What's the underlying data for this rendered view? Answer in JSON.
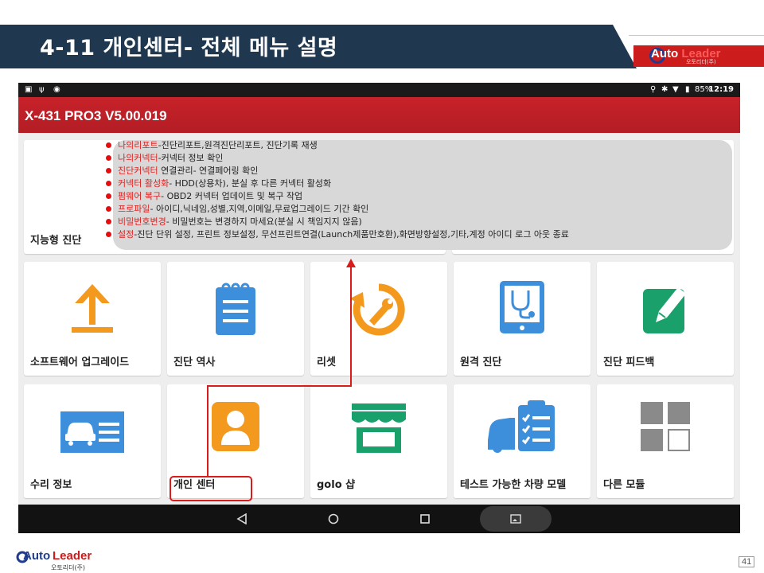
{
  "slide": {
    "title": "4-11 개인센터- 전체 메뉴 설명",
    "page_number": "41"
  },
  "logo": {
    "brand_auto": "Auto",
    "brand_leader": "Leader",
    "subtitle": "오토리더(주)"
  },
  "tablet": {
    "status": {
      "battery": "85%",
      "time": "12:19"
    },
    "app_title": "X-431 PRO3 V5.00.019",
    "top_tile_label": "지능형 진단",
    "tiles_row1": [
      {
        "label": "소프트웨어 업그레이드",
        "icon": "upload-arrow-icon",
        "color": "#f39a1e"
      },
      {
        "label": "진단 역사",
        "icon": "notepad-icon",
        "color": "#3d8fdc"
      },
      {
        "label": "리셋",
        "icon": "wrench-reset-icon",
        "color": "#f39a1e"
      },
      {
        "label": "원격 진단",
        "icon": "stethoscope-tablet-icon",
        "color": "#3d8fdc"
      },
      {
        "label": "진단 피드백",
        "icon": "pencil-note-icon",
        "color": "#1aa06a"
      }
    ],
    "tiles_row2": [
      {
        "label": "수리 정보",
        "icon": "car-info-card-icon",
        "color": "#3d8fdc"
      },
      {
        "label": "개인 센터",
        "icon": "person-icon",
        "color": "#f39a1e"
      },
      {
        "label": "golo 샵",
        "icon": "shop-awning-icon",
        "color": "#1aa06a"
      },
      {
        "label": "테스트 가능한 차량 모델",
        "icon": "car-checklist-icon",
        "color": "#3d8fdc"
      },
      {
        "label": "다른 모듈",
        "icon": "grid-modules-icon",
        "color": "#8a8a8a"
      }
    ]
  },
  "menu_notes": [
    {
      "key": "나의리포트",
      "text": "-진단리포트,원격진단리포트,  진단기록 재생"
    },
    {
      "key": "나의커넥터",
      "text": "-커넥터 정보 확인"
    },
    {
      "key": "진단커넥터",
      "text": " 연결관리- 연결페어링 확인"
    },
    {
      "key": "커넥터 활성화",
      "text": "- HDD(상용차), 분실 후 다른 커넥터 활성화"
    },
    {
      "key": "펌웨어 복구",
      "text": "- OBD2 커넥터 업데이트 및 복구 작업"
    },
    {
      "key": "프로파일",
      "text": "- 아이디,닉네임,성별,지역,이메일,무료업그레이드  기간 확인"
    },
    {
      "key": "비밀번호변경",
      "text": "- 비밀번호는 변경하지 마세요(분실 시 책임지지 않음)"
    },
    {
      "key": "설정",
      "text": "-진단 단위 설정, 프린트 정보설정, 무선프린트연결(Launch제품만호환),화면방향설정,기타,계정  아이디 로그 아웃 종료"
    }
  ]
}
